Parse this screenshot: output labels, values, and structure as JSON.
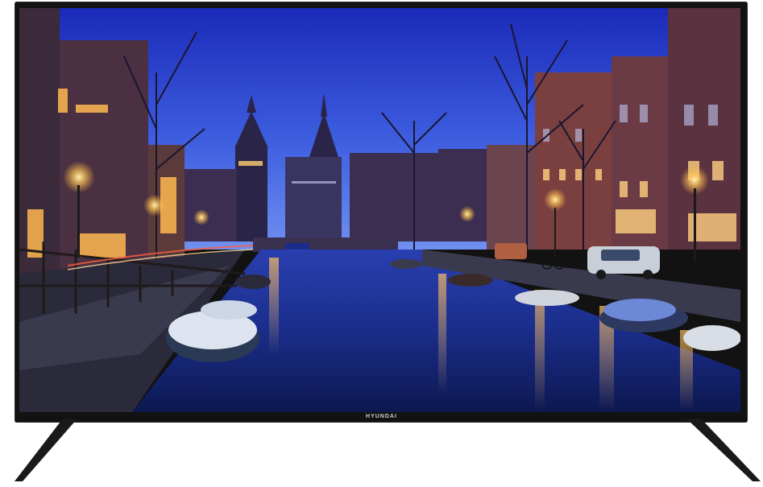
{
  "tv": {
    "brand": "HYUNDAI",
    "bezel_color": "#121212"
  },
  "screen": {
    "scene": "night-canal-cityscape",
    "colors": {
      "sky_top": "#1b2fbf",
      "sky_bottom": "#5a7ef0",
      "water": "#1a2d8a",
      "lamp_glow": "#ffd37a"
    }
  }
}
